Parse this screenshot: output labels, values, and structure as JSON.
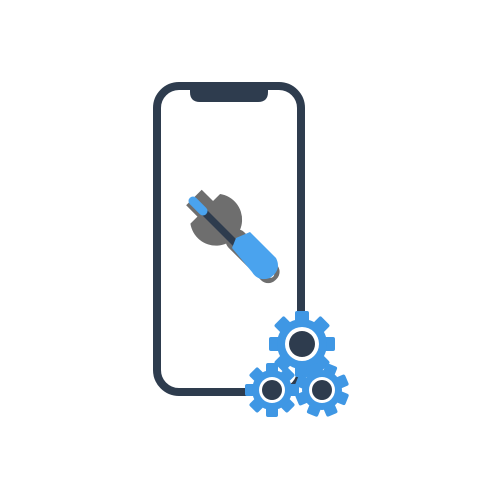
{
  "illustration": {
    "icons": [
      "smartphone-outline-icon",
      "screwdriver-icon",
      "wrench-icon",
      "gear-large-icon",
      "gear-small-left-icon",
      "gear-small-right-icon"
    ],
    "colors": {
      "outline": "#2e3c4e",
      "accent_blue": "#3f97e4",
      "accent_blue_light": "#5aaef0",
      "tool_gray": "#6e6e6e",
      "background": "#ffffff"
    }
  }
}
